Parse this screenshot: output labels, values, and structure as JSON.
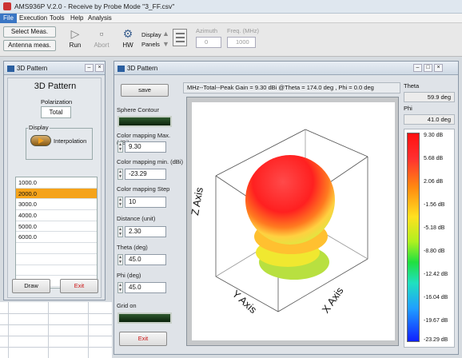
{
  "app": {
    "title": "AMS936P V.2.0 - Receive by Probe Mode \"3_FF.csv\""
  },
  "menu": [
    "File",
    "Execution",
    "Tools",
    "Help",
    "Analysis"
  ],
  "toolbar": {
    "select_meas": "Select Meas.",
    "antenna_meas": "Antenna meas.",
    "run": "Run",
    "abort": "Abort",
    "hw": "HW",
    "display": "Display",
    "panels": "Panels",
    "azimuth_label": "Azimuth",
    "azimuth_value": "0",
    "freq_label": "Freq. (MHz)",
    "freq_value": "1000"
  },
  "left_window": {
    "title": "3D Pattern",
    "heading": "3D Pattern",
    "polarization_label": "Polarization",
    "polarization_value": "Total",
    "display_label": "Display",
    "interpolation": "Interpolation",
    "frequencies": [
      "1000.0",
      "2000.0",
      "3000.0",
      "4000.0",
      "5000.0",
      "6000.0"
    ],
    "selected_index": 1,
    "draw": "Draw",
    "exit": "Exit"
  },
  "main_window": {
    "title": "3D Pattern",
    "save": "save",
    "sphere_contour": "Sphere Contour",
    "cmap_max_label": "Color mapping Max. (dBi)",
    "cmap_max": "9.30",
    "cmap_min_label": "Color mapping min. (dBi)",
    "cmap_min": "-23.29",
    "cmap_step_label": "Color mapping Step",
    "cmap_step": "10",
    "distance_label": "Distance (unit)",
    "distance": "2.30",
    "theta_label": "Theta (deg)",
    "theta": "45.0",
    "phi_label": "Phi (deg)",
    "phi": "45.0",
    "grid_on": "Grid on",
    "exit": "Exit",
    "status": "MHz--Total--Peak Gain = 9.30 dBi @Theta = 174.0 deg , Phi = 0.0 deg",
    "z_axis": "Z Axis",
    "y_axis": "Y Axis",
    "x_axis": "X Axis",
    "theta_head": "Theta",
    "theta_readout": "59.9 deg",
    "phi_head": "Phi",
    "phi_readout": "41.0 deg",
    "colorbar_labels": [
      "9.30 dB",
      "5.68 dB",
      "2.06 dB",
      "-1.56 dB",
      "-5.18 dB",
      "-8.80 dB",
      "-12.42 dB",
      "-16.04 dB",
      "-19.67 dB",
      "-23.29 dB"
    ]
  },
  "colors": {
    "accent": "#3a76c4",
    "selected_row": "#f5a31a",
    "exit_text": "#cc1111",
    "grid_bar": "#1e3d1e"
  }
}
